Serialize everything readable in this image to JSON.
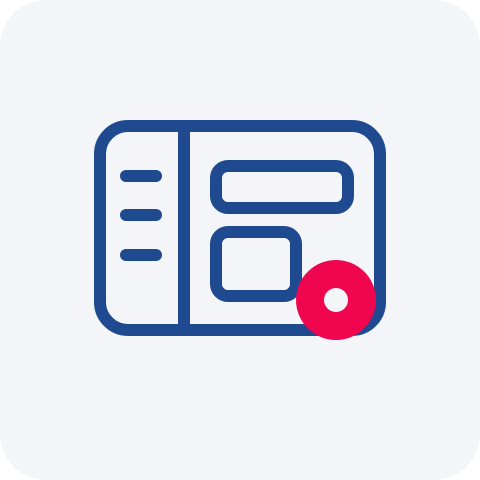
{
  "icon": {
    "name": "dashboard-layout-icon",
    "badge": "notification-dot-icon"
  },
  "colors": {
    "background": "#f3f5f9",
    "stroke": "#1f4a8f",
    "badge": "#f0064f",
    "badge_center": "#f3f5f9"
  }
}
